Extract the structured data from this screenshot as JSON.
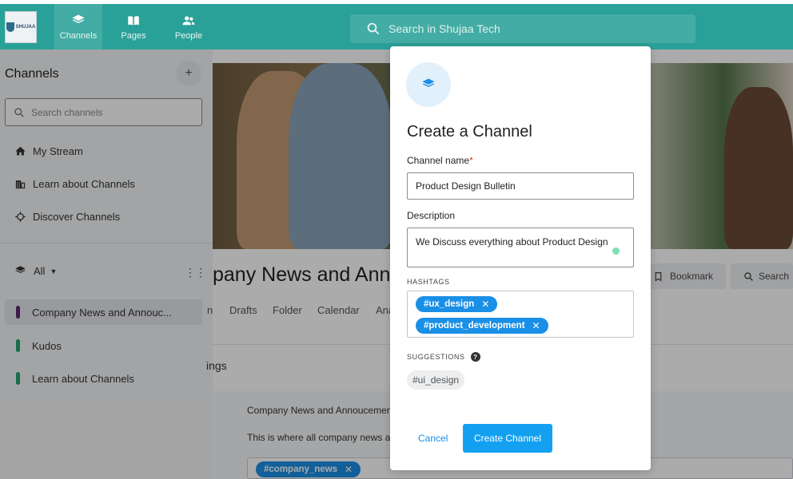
{
  "topbar": {
    "logo_text": "SHUJAA",
    "nav": [
      {
        "label": "Channels",
        "icon": "layers-icon"
      },
      {
        "label": "Pages",
        "icon": "book-icon"
      },
      {
        "label": "People",
        "icon": "people-icon"
      }
    ],
    "search_placeholder": "Search in Shujaa Tech"
  },
  "sidebar": {
    "title": "Channels",
    "add_label": "+",
    "search_placeholder": "Search channels",
    "links": [
      {
        "label": "My Stream",
        "icon": "home-icon"
      },
      {
        "label": "Learn about Channels",
        "icon": "building-icon"
      },
      {
        "label": "Discover Channels",
        "icon": "compass-icon"
      }
    ],
    "filter_label": "All",
    "channels": [
      {
        "label": "Company News and Annouc...",
        "color": "#5b2a6e",
        "active": true
      },
      {
        "label": "Kudos",
        "color": "#23a36b",
        "active": false
      },
      {
        "label": "Learn about Channels",
        "color": "#23a36b",
        "active": false
      }
    ]
  },
  "main": {
    "title": "pany News and Ann",
    "bookmark_label": "Bookmark",
    "search_label": "Search",
    "tabs": [
      "n",
      "Drafts",
      "Folder",
      "Calendar",
      "Ana"
    ],
    "settings_label": "ings",
    "about_title": "Company News and Annoucemen",
    "about_desc": "This is where all company news a",
    "about_tag": "#company_news"
  },
  "modal": {
    "title": "Create a Channel",
    "name_label": "Channel name",
    "required_mark": "*",
    "name_value": "Product Design Bulletin",
    "desc_label": "Description",
    "desc_value": "We Discuss everything about Product Design",
    "hashtags_label": "HASHTAGS",
    "hashtags": [
      "#ux_design",
      "#product_development"
    ],
    "suggestions_label": "SUGGESTIONS",
    "help_glyph": "?",
    "suggestions": [
      "#ui_design"
    ],
    "cancel_label": "Cancel",
    "create_label": "Create Channel"
  },
  "colors": {
    "brand_teal": "#2aa198",
    "accent_blue": "#14a0f0",
    "chip_blue": "#1a8fe6"
  }
}
